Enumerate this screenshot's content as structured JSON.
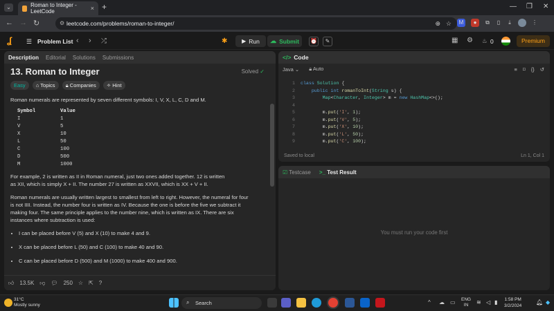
{
  "browser": {
    "tab_title": "Roman to Integer - LeetCode",
    "url": "leetcode.com/problems/roman-to-integer/"
  },
  "nav": {
    "problem_list": "Problem List",
    "run": "Run",
    "submit": "Submit",
    "streak": "0",
    "premium": "Premium"
  },
  "left_tabs": [
    "Description",
    "Editorial",
    "Solutions",
    "Submissions"
  ],
  "problem": {
    "title": "13. Roman to Integer",
    "solved": "Solved",
    "chips": [
      "Easy",
      "Topics",
      "Companies",
      "Hint"
    ],
    "intro": "Roman numerals are represented by seven different symbols: I, V, X, L, C, D and M.",
    "table_header": [
      "Symbol",
      "Value"
    ],
    "table_rows": [
      [
        "I",
        "1"
      ],
      [
        "V",
        "5"
      ],
      [
        "X",
        "10"
      ],
      [
        "L",
        "50"
      ],
      [
        "C",
        "100"
      ],
      [
        "D",
        "500"
      ],
      [
        "M",
        "1000"
      ]
    ],
    "p2_line1": "For example, 2 is written as II in Roman numeral, just two ones added together. 12 is written",
    "p2_line2": "as XII, which is simply X + II. The number 27 is written as XXVII, which is XX + V + II.",
    "p3_line1": "Roman numerals are usually written largest to smallest from left to right. However, the numeral for four",
    "p3_line2": "is not IIII. Instead, the number four is written as IV. Because the one is before the five we subtract it",
    "p3_line3": "making four. The same principle applies to the number nine, which is written as IX. There are six",
    "p3_line4": "instances where subtraction is used:",
    "bullets": [
      "I can be placed before V (5) and X (10) to make 4 and 9.",
      "X can be placed before L (50) and C (100) to make 40 and 90.",
      "C can be placed before D (500) and M (1000) to make 400 and 900."
    ],
    "likes": "13.5K",
    "comments": "250"
  },
  "code": {
    "header": "Code",
    "language": "Java",
    "mode": "Auto",
    "line_numbers": [
      "1",
      "2",
      "3",
      "4",
      "5",
      "6",
      "7",
      "8",
      "9"
    ],
    "saved": "Saved to local",
    "cursor": "Ln 1, Col 1"
  },
  "test": {
    "tab_testcase": "Testcase",
    "tab_result": "Test Result",
    "empty": "You must run your code first"
  },
  "taskbar": {
    "temp": "31°C",
    "weather": "Mostly sunny",
    "search": "Search",
    "lang1": "ENG",
    "lang2": "IN",
    "time": "1:58 PM",
    "date": "3/2/2024"
  }
}
